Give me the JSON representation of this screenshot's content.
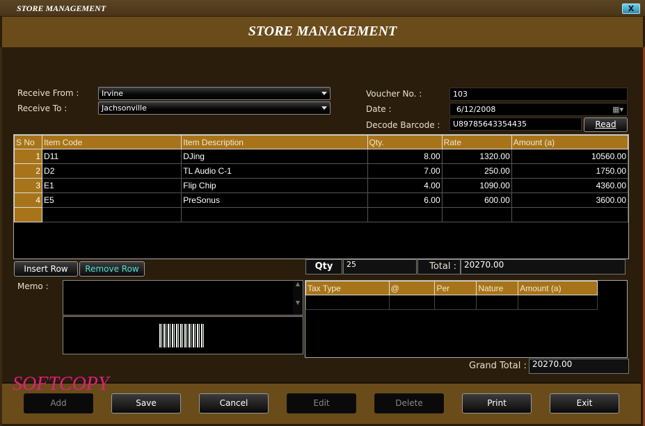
{
  "window": {
    "title": "STORE MANAGEMENT",
    "close_label": "X"
  },
  "header": {
    "title": "STORE MANAGEMENT"
  },
  "form": {
    "receive_from_label": "Receive From :",
    "receive_from_value": "Irvine",
    "receive_to_label": "Receive To :",
    "receive_to_value": "Jachsonville",
    "voucher_label": "Voucher No. :",
    "voucher_value": "103",
    "date_label": "Date :",
    "date_value": "6/12/2008",
    "barcode_label": "Decode Barcode :",
    "barcode_value": "U89785643354435",
    "read_label": "Read"
  },
  "items_table": {
    "columns": [
      "S No",
      "Item Code",
      "Item Description",
      "Qty.",
      "Rate",
      "Amount (a)"
    ],
    "rows": [
      {
        "sno": "1",
        "code": "D11",
        "desc": "DJing",
        "qty": "8.00",
        "rate": "1320.00",
        "amount": "10560.00"
      },
      {
        "sno": "2",
        "code": "D2",
        "desc": "TL Audio C-1",
        "qty": "7.00",
        "rate": "250.00",
        "amount": "1750.00"
      },
      {
        "sno": "3",
        "code": "E1",
        "desc": "Flip Chip",
        "qty": "4.00",
        "rate": "1090.00",
        "amount": "4360.00"
      },
      {
        "sno": "4",
        "code": "E5",
        "desc": "PreSonus",
        "qty": "6.00",
        "rate": "600.00",
        "amount": "3600.00"
      }
    ]
  },
  "row_actions": {
    "insert": "Insert Row",
    "remove": "Remove Row"
  },
  "summary": {
    "qty_label": "Qty",
    "qty_value": "25",
    "total_label": "Total :",
    "total_value": "20270.00",
    "grand_total_label": "Grand Total :",
    "grand_total_value": "20270.00"
  },
  "memo": {
    "label": "Memo :",
    "value": ""
  },
  "tax_table": {
    "columns": [
      "Tax Type",
      "@",
      "Per",
      "Nature",
      "Amount (a)"
    ]
  },
  "watermark": "SOFTCOPY",
  "footer": {
    "buttons": [
      "Add",
      "Save",
      "Cancel",
      "Edit",
      "Delete",
      "Print",
      "Exit"
    ]
  },
  "colors": {
    "accent": "#a8741a",
    "header_bg": "#6a4b1a",
    "body_bg": "#2a1d0c",
    "watermark": "#e0207a",
    "remove_row_text": "#4fe0d0"
  }
}
